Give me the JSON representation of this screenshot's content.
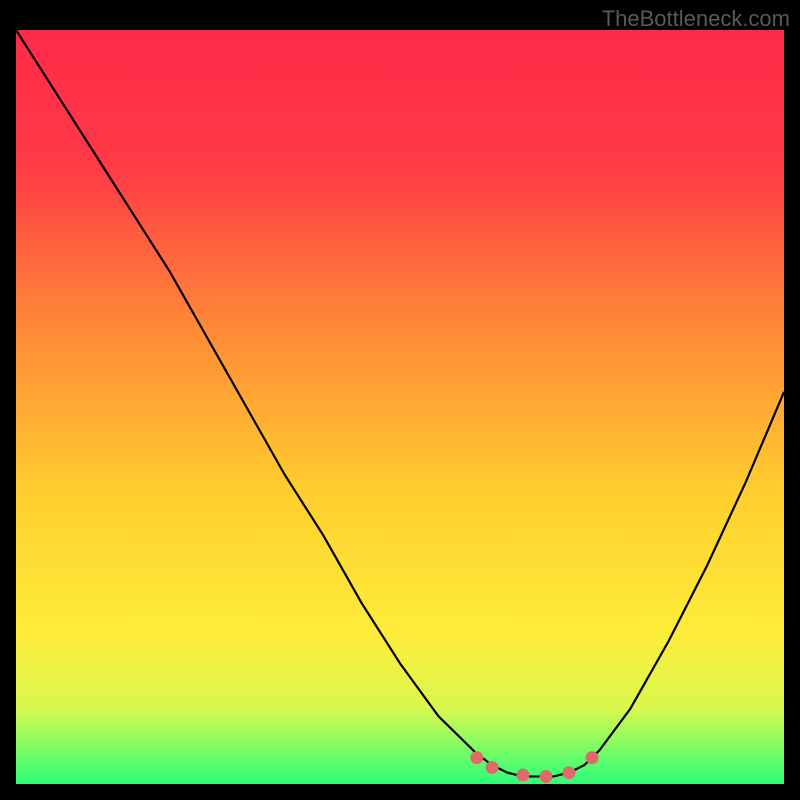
{
  "watermark": "TheBottleneck.com",
  "chart_data": {
    "type": "line",
    "title": "",
    "xlabel": "",
    "ylabel": "",
    "xlim": [
      0,
      100
    ],
    "ylim": [
      0,
      100
    ],
    "background_gradient": {
      "top": "#ff2a4a",
      "mid": "#ffd32a",
      "bottom": "#2aff7a"
    },
    "series": [
      {
        "name": "curve",
        "color": "#000000",
        "x": [
          0,
          5,
          10,
          15,
          20,
          25,
          30,
          35,
          40,
          45,
          50,
          55,
          60,
          62,
          64,
          66,
          68,
          70,
          72,
          74,
          76,
          80,
          85,
          90,
          95,
          100
        ],
        "y": [
          100,
          92,
          84,
          76,
          68,
          59,
          50,
          41,
          33,
          24,
          16,
          9,
          4,
          2.5,
          1.5,
          1,
          1,
          1,
          1.5,
          2.5,
          4.5,
          10,
          19,
          29,
          40,
          52
        ]
      }
    ],
    "markers": [
      {
        "name": "marker-1",
        "x": 60,
        "y": 3.5,
        "color": "#e06a6a"
      },
      {
        "name": "marker-2",
        "x": 62,
        "y": 2.2,
        "color": "#e06a6a"
      },
      {
        "name": "marker-3",
        "x": 66,
        "y": 1.2,
        "color": "#e06a6a"
      },
      {
        "name": "marker-4",
        "x": 69,
        "y": 1.0,
        "color": "#e06a6a"
      },
      {
        "name": "marker-5",
        "x": 72,
        "y": 1.5,
        "color": "#e06a6a"
      },
      {
        "name": "marker-6",
        "x": 75,
        "y": 3.5,
        "color": "#e06a6a"
      }
    ]
  }
}
